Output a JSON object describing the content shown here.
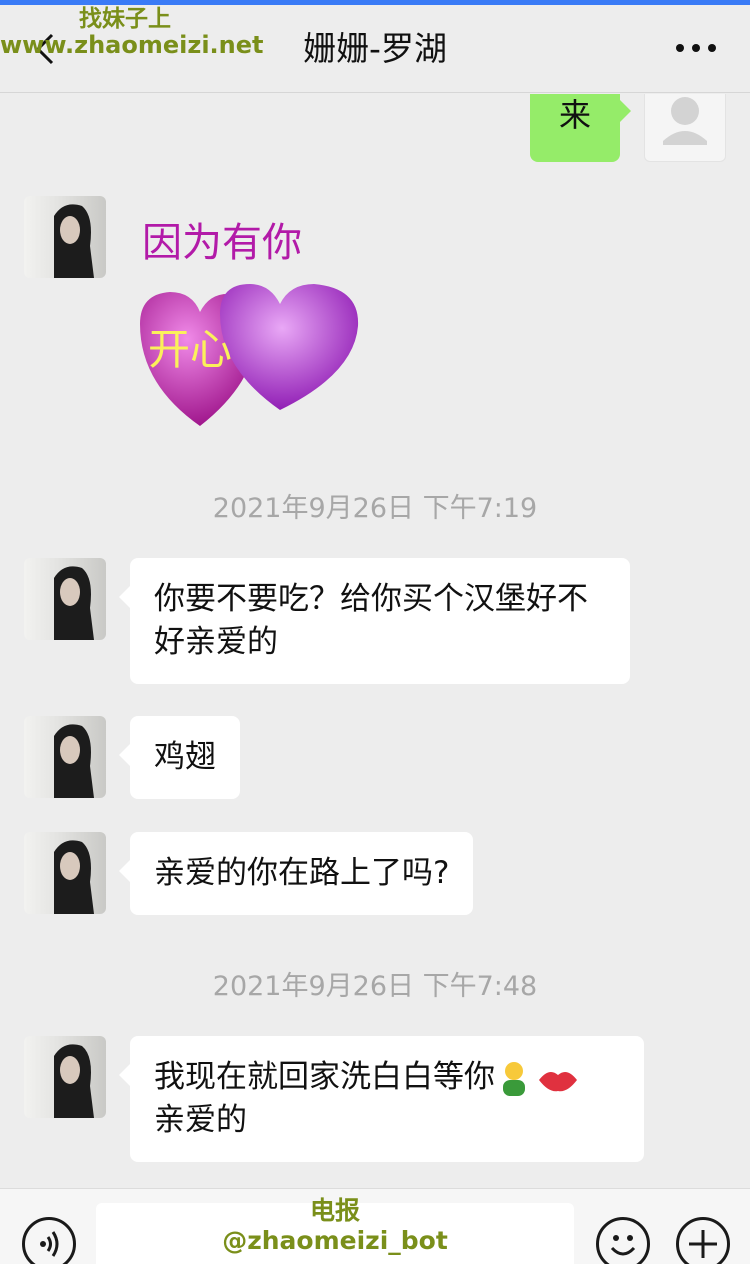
{
  "app": {
    "title": "姗姗-罗湖"
  },
  "watermark": {
    "top_line1": "找妹子上",
    "top_line2": "www.zhaomeizi.net",
    "bottom_line1": "电报",
    "bottom_line2": "@zhaomeizi_bot"
  },
  "messages": {
    "m1": "来",
    "m3": "你要不要吃？给你买个汉堡好不好亲爱的",
    "m4": "鸡翅",
    "m5": "亲爱的你在路上了吗?",
    "m6_text": "我现在就回家洗白白等你",
    "m6_tail": "亲爱的"
  },
  "sticker": {
    "line1": "因为有你",
    "line2": "开心"
  },
  "timestamps": {
    "t1": "2021年9月26日 下午7:19",
    "t2": "2021年9月26日 下午7:48"
  },
  "icons": {
    "back": "chevron-left-icon",
    "more": "more-dots-icon",
    "voice": "voice-icon",
    "emoji": "emoji-icon",
    "plus": "plus-icon"
  },
  "colors": {
    "accent_bar": "#3a7bf6",
    "own_bubble": "#95ec69",
    "timestamp": "#a7a7a7",
    "watermark": "#7a8f1a"
  }
}
